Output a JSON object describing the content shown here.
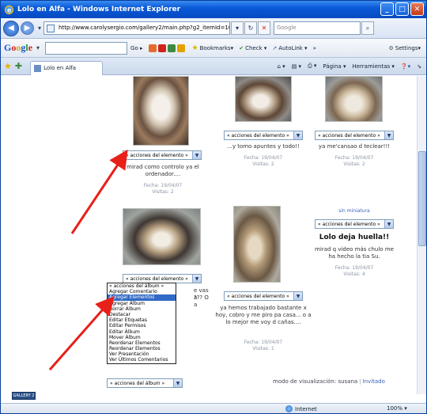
{
  "window": {
    "title": "Lolo en Alfa - Windows Internet Explorer"
  },
  "address": {
    "url": "http://www.carolysergio.com/gallery2/main.php?g2_itemId=1046&g2_fromNavId",
    "search_placeholder": "Google"
  },
  "google_toolbar": {
    "logo_letters": [
      "G",
      "o",
      "o",
      "g",
      "l",
      "e"
    ],
    "go_label": "Go",
    "bookmarks": "Bookmarks▾",
    "check": "Check ▾",
    "autolink": "AutoLink ▾",
    "more": "»",
    "settings": "Settings▾"
  },
  "tabs": [
    {
      "label": "Lolo en Alfa"
    }
  ],
  "command_bar": {
    "page": "Página ▾",
    "tools": "Herramientas ▾"
  },
  "gallery": {
    "action_select": "« acciones del elemento »",
    "items": [
      {
        "caption": "mirad como controlo ya el ordenador....",
        "date": "Fecha: 19/04/07",
        "views": "Visitas: 2"
      },
      {
        "caption": "...y tomo apuntes y todo!!",
        "date": "Fecha: 19/04/07",
        "views": "Visitas: 2"
      },
      {
        "caption": "ya me'cansao d teclear!!!",
        "date": "Fecha: 19/04/07",
        "views": "Visitas: 2"
      },
      {
        "caption": "",
        "date": "",
        "views": ""
      },
      {
        "caption": "ya hemos trabajado bastante x hoy, cobro y me piro pa casa... o a lo mejor me voy d cañas....",
        "date": "Fecha: 19/04/07",
        "views": "Visitas: 1"
      },
      {
        "link": "sin miniatura",
        "title": "Lolo deja huella!!",
        "caption": "mirad q video más chulo me ha hecho la tia Su.",
        "date": "Fecha: 19/04/07",
        "views": "Visitas: 4"
      }
    ],
    "partial_caption_right": "e vas a",
    "partial_caption_right2": "??? O",
    "partial_caption_right3": "a"
  },
  "album_menu": {
    "selected": "« acciones del álbum »",
    "options": [
      "« acciones del álbum »",
      "Agregar Comentario",
      "Agregar Elementos",
      "Agregar Álbum",
      "Borrar Álbum",
      "Destacar",
      "Editar Etiquetas",
      "Editar Permisos",
      "Editar Álbum",
      "Mover Álbum",
      "Reordenar Elementos",
      "Reordenar Elementos",
      "Ver Presentación",
      "Ver Últimos Comentarios"
    ],
    "highlighted_index": 2
  },
  "footer": {
    "mode_label": "modo de visualización: susana",
    "separator": "|",
    "guest_link": "Invitado",
    "badge": "GALLERY 2"
  },
  "status": {
    "zone": "Internet",
    "zoom": "100%  ▾"
  },
  "colors": {
    "title_bar": "#0a5ad8",
    "highlight": "#316ac5",
    "link": "#3a62b8",
    "arrow": "#e8201a"
  }
}
